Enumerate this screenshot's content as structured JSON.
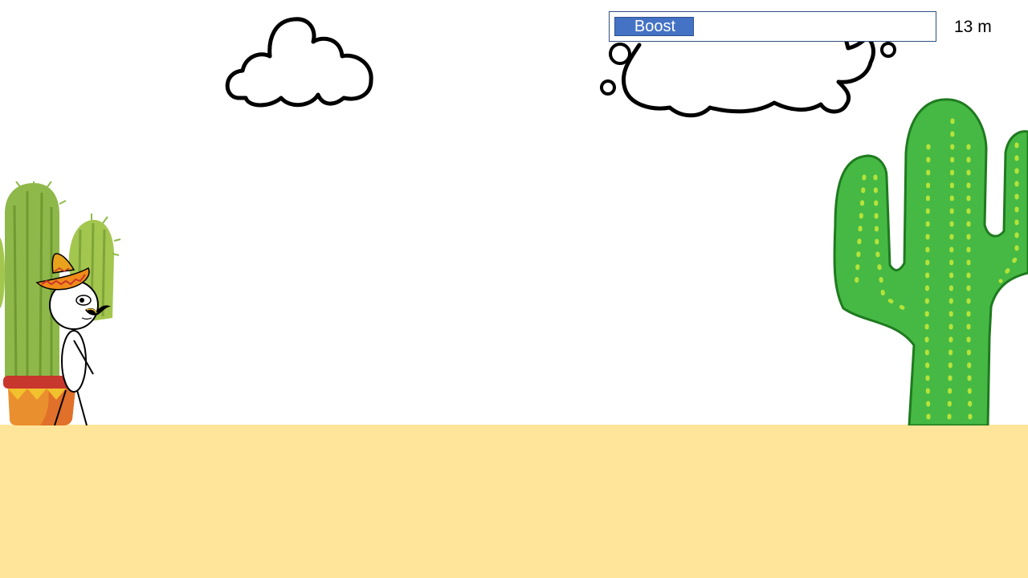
{
  "hud": {
    "boost": {
      "label": "Boost",
      "level": 0.25
    },
    "distance": {
      "text": "13 m"
    }
  },
  "colors": {
    "sky": "#ffffff",
    "sand": "#fee599",
    "boost_fill": "#4472c4",
    "boost_border": "#2f4f7f",
    "cactus_big": "#45b944",
    "cactus_big_outline": "#1f7a1f",
    "cactus_big_dots": "#b6e23a",
    "cactus_pot": "#8fb84a",
    "pot": "#ea8f2e",
    "pot_rim": "#c8372d"
  },
  "scene": {
    "objects": [
      "cloud-icon",
      "thought-cloud-icon",
      "potted-cactus-icon",
      "saguaro-cactus-icon",
      "sombrero-stick-figure-player"
    ]
  }
}
